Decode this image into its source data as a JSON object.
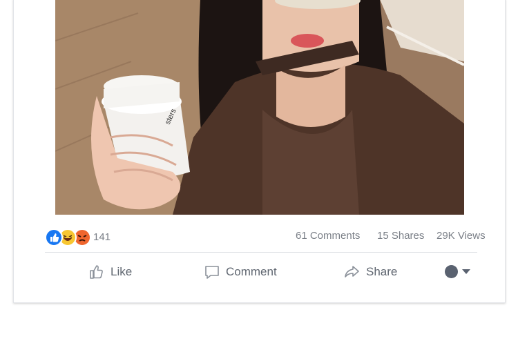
{
  "post": {
    "reactions": {
      "icons": [
        "like-icon",
        "haha-icon",
        "angry-icon"
      ],
      "count": "141"
    },
    "stats": {
      "comments": "61 Comments",
      "shares": "15 Shares",
      "views": "29K Views"
    },
    "actions": {
      "like": "Like",
      "comment": "Comment",
      "share": "Share"
    },
    "colors": {
      "like_blue": "#1877f2",
      "emoji_yellow": "#f7c631",
      "angry_orange": "#f0662e",
      "muted_text": "#7a7f87"
    }
  }
}
